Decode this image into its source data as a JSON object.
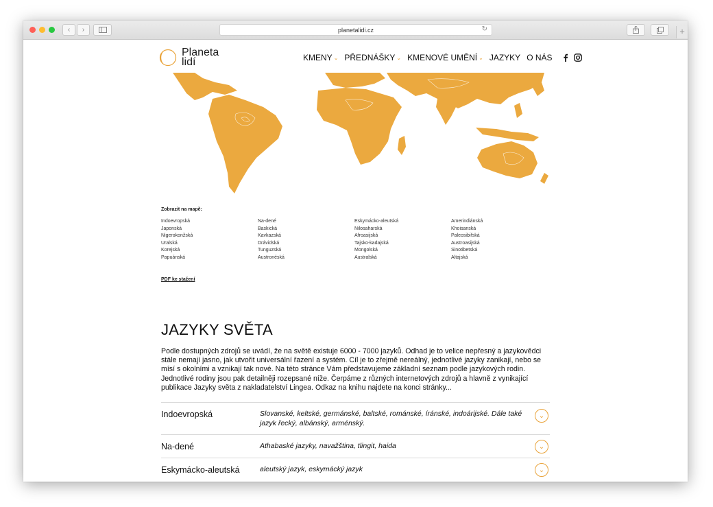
{
  "browser": {
    "url": "planetalidi.cz",
    "colors": {
      "close": "#ff5f57",
      "minimize": "#febc2e",
      "maximize": "#28c840"
    }
  },
  "site": {
    "logo_line1": "Planeta",
    "logo_line2": "lidí",
    "accent": "#e9a33a"
  },
  "nav": {
    "items": [
      "KMENY",
      "PŘEDNÁŠKY",
      "KMENOVÉ UMĚNÍ",
      "JAZYKY",
      "O NÁS"
    ],
    "social": [
      "facebook-icon",
      "instagram-icon"
    ]
  },
  "map_legend": {
    "title": "Zobrazit na mapě:",
    "columns": [
      [
        "Indoevropská",
        "Japonská",
        "Nigerokonžská",
        "Uralská",
        "Korejská",
        "Papuánská"
      ],
      [
        "Na-dené",
        "Baskická",
        "Kavkazská",
        "Drávidská",
        "Tunguzská",
        "Austronéská"
      ],
      [
        "Eskymácko-aleutská",
        "Nilosaharská",
        "Afroasijská",
        "Tajsko-kadajská",
        "Mongolská",
        "Australská"
      ],
      [
        "Amerindiánská",
        "Khoisanská",
        "Paleosibiřská",
        "Austroasijská",
        "Sinotibetská",
        "Altajská"
      ]
    ],
    "pdf_link": "PDF ke stažení"
  },
  "main": {
    "title": "JAZYKY SVĚTA",
    "intro": "Podle dostupných zdrojů se uvádí, že na světě existuje 6000 - 7000 jazyků. Odhad je to velice nepřesný a jazykovědci stále nemají jasno, jak utvořit universální řazení a systém. Cíl je to zřejmě nereálný, jednotlivé jazyky zanikají, nebo se mísí s okolními a vznikají tak nové. Na této stránce Vám představujeme základní seznam podle jazykových rodin. Jednotlivé rodiny jsou pak detailněji rozepsané níže. Čerpáme z různých internetových zdrojů a hlavně z vynikající publikace Jazyky světa z nakladatelství Lingea. Odkaz na knihu najdete na konci stránky...",
    "families": [
      {
        "name": "Indoevropská",
        "desc": "Slovanské, keltské, germánské, baltské, románské, íránské, indoárijské. Dále také jazyk řecký, albánský, arménský."
      },
      {
        "name": "Na-dené",
        "desc": "Athabaské jazyky, navažština, tlingit, haida"
      },
      {
        "name": "Eskymácko-aleutská",
        "desc": "aleutský jazyk, eskymácký jazyk"
      }
    ]
  }
}
